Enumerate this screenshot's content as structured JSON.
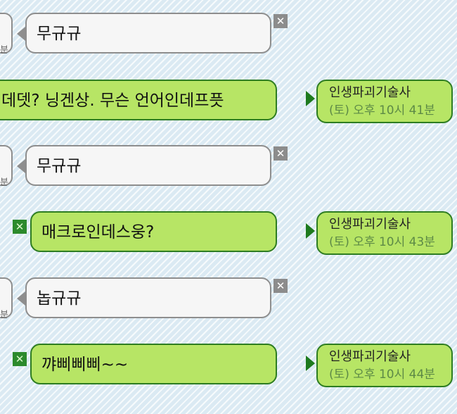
{
  "messages": [
    {
      "type": "incoming",
      "text": "무규규",
      "stub": "분"
    },
    {
      "type": "outgoing",
      "text": "데뎃? 닝겐상. 무슨 언어인데프픗",
      "sender": "인생파괴기술사",
      "time": "(토) 오후 10시 41분"
    },
    {
      "type": "incoming",
      "text": "무규규",
      "stub": "분"
    },
    {
      "type": "outgoing",
      "text": "매크로인데스웅?",
      "sender": "인생파괴기술사",
      "time": "(토) 오후 10시 43분"
    },
    {
      "type": "incoming",
      "text": "놉규규",
      "stub": "분"
    },
    {
      "type": "outgoing",
      "text": "꺄삐삐삐~~",
      "sender": "인생파괴기술사",
      "time": "(토) 오후 10시 44분"
    }
  ],
  "icons": {
    "close": "✕",
    "close_glyph": "✕"
  },
  "colors": {
    "green_bubble": "#b7e565",
    "green_border": "#2e7d22",
    "gray_border": "#8e8e8e"
  }
}
